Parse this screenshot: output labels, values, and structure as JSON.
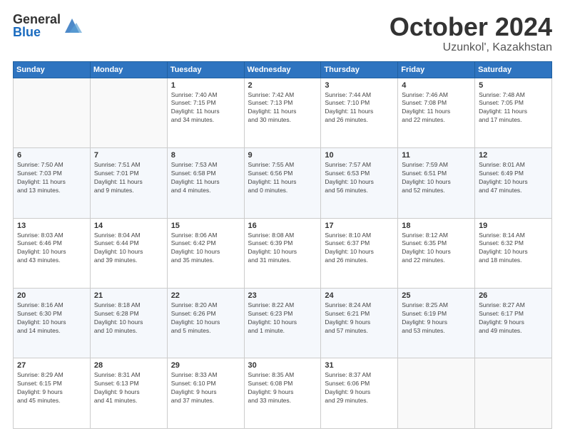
{
  "logo": {
    "general": "General",
    "blue": "Blue"
  },
  "header": {
    "month": "October 2024",
    "location": "Uzunkol', Kazakhstan"
  },
  "weekdays": [
    "Sunday",
    "Monday",
    "Tuesday",
    "Wednesday",
    "Thursday",
    "Friday",
    "Saturday"
  ],
  "weeks": [
    [
      {
        "day": null,
        "info": null
      },
      {
        "day": null,
        "info": null
      },
      {
        "day": "1",
        "info": "Sunrise: 7:40 AM\nSunset: 7:15 PM\nDaylight: 11 hours\nand 34 minutes."
      },
      {
        "day": "2",
        "info": "Sunrise: 7:42 AM\nSunset: 7:13 PM\nDaylight: 11 hours\nand 30 minutes."
      },
      {
        "day": "3",
        "info": "Sunrise: 7:44 AM\nSunset: 7:10 PM\nDaylight: 11 hours\nand 26 minutes."
      },
      {
        "day": "4",
        "info": "Sunrise: 7:46 AM\nSunset: 7:08 PM\nDaylight: 11 hours\nand 22 minutes."
      },
      {
        "day": "5",
        "info": "Sunrise: 7:48 AM\nSunset: 7:05 PM\nDaylight: 11 hours\nand 17 minutes."
      }
    ],
    [
      {
        "day": "6",
        "info": "Sunrise: 7:50 AM\nSunset: 7:03 PM\nDaylight: 11 hours\nand 13 minutes."
      },
      {
        "day": "7",
        "info": "Sunrise: 7:51 AM\nSunset: 7:01 PM\nDaylight: 11 hours\nand 9 minutes."
      },
      {
        "day": "8",
        "info": "Sunrise: 7:53 AM\nSunset: 6:58 PM\nDaylight: 11 hours\nand 4 minutes."
      },
      {
        "day": "9",
        "info": "Sunrise: 7:55 AM\nSunset: 6:56 PM\nDaylight: 11 hours\nand 0 minutes."
      },
      {
        "day": "10",
        "info": "Sunrise: 7:57 AM\nSunset: 6:53 PM\nDaylight: 10 hours\nand 56 minutes."
      },
      {
        "day": "11",
        "info": "Sunrise: 7:59 AM\nSunset: 6:51 PM\nDaylight: 10 hours\nand 52 minutes."
      },
      {
        "day": "12",
        "info": "Sunrise: 8:01 AM\nSunset: 6:49 PM\nDaylight: 10 hours\nand 47 minutes."
      }
    ],
    [
      {
        "day": "13",
        "info": "Sunrise: 8:03 AM\nSunset: 6:46 PM\nDaylight: 10 hours\nand 43 minutes."
      },
      {
        "day": "14",
        "info": "Sunrise: 8:04 AM\nSunset: 6:44 PM\nDaylight: 10 hours\nand 39 minutes."
      },
      {
        "day": "15",
        "info": "Sunrise: 8:06 AM\nSunset: 6:42 PM\nDaylight: 10 hours\nand 35 minutes."
      },
      {
        "day": "16",
        "info": "Sunrise: 8:08 AM\nSunset: 6:39 PM\nDaylight: 10 hours\nand 31 minutes."
      },
      {
        "day": "17",
        "info": "Sunrise: 8:10 AM\nSunset: 6:37 PM\nDaylight: 10 hours\nand 26 minutes."
      },
      {
        "day": "18",
        "info": "Sunrise: 8:12 AM\nSunset: 6:35 PM\nDaylight: 10 hours\nand 22 minutes."
      },
      {
        "day": "19",
        "info": "Sunrise: 8:14 AM\nSunset: 6:32 PM\nDaylight: 10 hours\nand 18 minutes."
      }
    ],
    [
      {
        "day": "20",
        "info": "Sunrise: 8:16 AM\nSunset: 6:30 PM\nDaylight: 10 hours\nand 14 minutes."
      },
      {
        "day": "21",
        "info": "Sunrise: 8:18 AM\nSunset: 6:28 PM\nDaylight: 10 hours\nand 10 minutes."
      },
      {
        "day": "22",
        "info": "Sunrise: 8:20 AM\nSunset: 6:26 PM\nDaylight: 10 hours\nand 5 minutes."
      },
      {
        "day": "23",
        "info": "Sunrise: 8:22 AM\nSunset: 6:23 PM\nDaylight: 10 hours\nand 1 minute."
      },
      {
        "day": "24",
        "info": "Sunrise: 8:24 AM\nSunset: 6:21 PM\nDaylight: 9 hours\nand 57 minutes."
      },
      {
        "day": "25",
        "info": "Sunrise: 8:25 AM\nSunset: 6:19 PM\nDaylight: 9 hours\nand 53 minutes."
      },
      {
        "day": "26",
        "info": "Sunrise: 8:27 AM\nSunset: 6:17 PM\nDaylight: 9 hours\nand 49 minutes."
      }
    ],
    [
      {
        "day": "27",
        "info": "Sunrise: 8:29 AM\nSunset: 6:15 PM\nDaylight: 9 hours\nand 45 minutes."
      },
      {
        "day": "28",
        "info": "Sunrise: 8:31 AM\nSunset: 6:13 PM\nDaylight: 9 hours\nand 41 minutes."
      },
      {
        "day": "29",
        "info": "Sunrise: 8:33 AM\nSunset: 6:10 PM\nDaylight: 9 hours\nand 37 minutes."
      },
      {
        "day": "30",
        "info": "Sunrise: 8:35 AM\nSunset: 6:08 PM\nDaylight: 9 hours\nand 33 minutes."
      },
      {
        "day": "31",
        "info": "Sunrise: 8:37 AM\nSunset: 6:06 PM\nDaylight: 9 hours\nand 29 minutes."
      },
      {
        "day": null,
        "info": null
      },
      {
        "day": null,
        "info": null
      }
    ]
  ]
}
